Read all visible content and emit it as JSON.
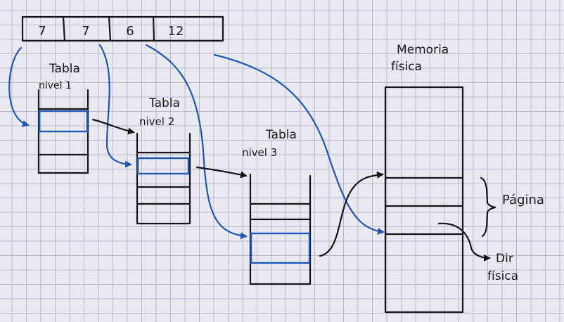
{
  "address_fields": [
    "7",
    "7",
    "6",
    "12"
  ],
  "tables": [
    {
      "line1": "Tabla",
      "line2": "nivel 1"
    },
    {
      "line1": "Tabla",
      "line2": "nivel 2"
    },
    {
      "line1": "Tabla",
      "line2": "nivel 3"
    }
  ],
  "memory": {
    "line1": "Memoria",
    "line2": "física"
  },
  "page_label": "Página",
  "phys_addr": {
    "line1": "Dir",
    "line2": "física"
  },
  "colors": {
    "ink": "#151515",
    "pointer": "#1f57b6",
    "grid": "#b9b9cf",
    "paper": "#e9e9ef"
  }
}
